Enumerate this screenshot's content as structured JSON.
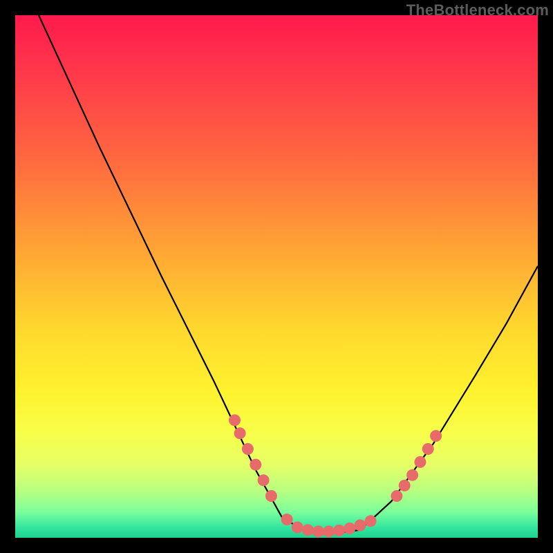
{
  "watermark": "TheBottleneck.com",
  "chart_data": {
    "type": "line",
    "title": "",
    "xlabel": "",
    "ylabel": "",
    "xlim": [
      0,
      100
    ],
    "ylim": [
      0,
      100
    ],
    "series": [
      {
        "name": "curve-left",
        "points": [
          {
            "x": 4.5,
            "y": 100
          },
          {
            "x": 16,
            "y": 75
          },
          {
            "x": 28,
            "y": 50
          },
          {
            "x": 38,
            "y": 30
          },
          {
            "x": 46,
            "y": 13
          },
          {
            "x": 51,
            "y": 4
          },
          {
            "x": 55,
            "y": 1.5
          }
        ]
      },
      {
        "name": "flat-bottom",
        "points": [
          {
            "x": 55,
            "y": 1.5
          },
          {
            "x": 58,
            "y": 1
          },
          {
            "x": 62,
            "y": 1
          },
          {
            "x": 66,
            "y": 1.5
          }
        ]
      },
      {
        "name": "curve-right",
        "points": [
          {
            "x": 66,
            "y": 1.5
          },
          {
            "x": 72,
            "y": 7
          },
          {
            "x": 80,
            "y": 18
          },
          {
            "x": 88,
            "y": 31
          },
          {
            "x": 94,
            "y": 41
          },
          {
            "x": 100,
            "y": 52
          }
        ]
      },
      {
        "name": "dots-left-cluster",
        "points": [
          {
            "x": 42,
            "y": 22.5
          },
          {
            "x": 43,
            "y": 20
          },
          {
            "x": 44.5,
            "y": 17
          },
          {
            "x": 46,
            "y": 14
          },
          {
            "x": 47.5,
            "y": 11
          },
          {
            "x": 49,
            "y": 8
          }
        ]
      },
      {
        "name": "dots-bottom-cluster",
        "points": [
          {
            "x": 52,
            "y": 3.5
          },
          {
            "x": 54,
            "y": 2
          },
          {
            "x": 56,
            "y": 1.5
          },
          {
            "x": 58,
            "y": 1.2
          },
          {
            "x": 60,
            "y": 1.2
          },
          {
            "x": 62,
            "y": 1.4
          },
          {
            "x": 64,
            "y": 1.8
          },
          {
            "x": 66,
            "y": 2.4
          },
          {
            "x": 68,
            "y": 3.2
          }
        ]
      },
      {
        "name": "dots-right-cluster",
        "points": [
          {
            "x": 73,
            "y": 8
          },
          {
            "x": 74.5,
            "y": 10
          },
          {
            "x": 76,
            "y": 12
          },
          {
            "x": 77.5,
            "y": 14.5
          },
          {
            "x": 79,
            "y": 17
          },
          {
            "x": 80.5,
            "y": 19.5
          }
        ]
      }
    ]
  }
}
